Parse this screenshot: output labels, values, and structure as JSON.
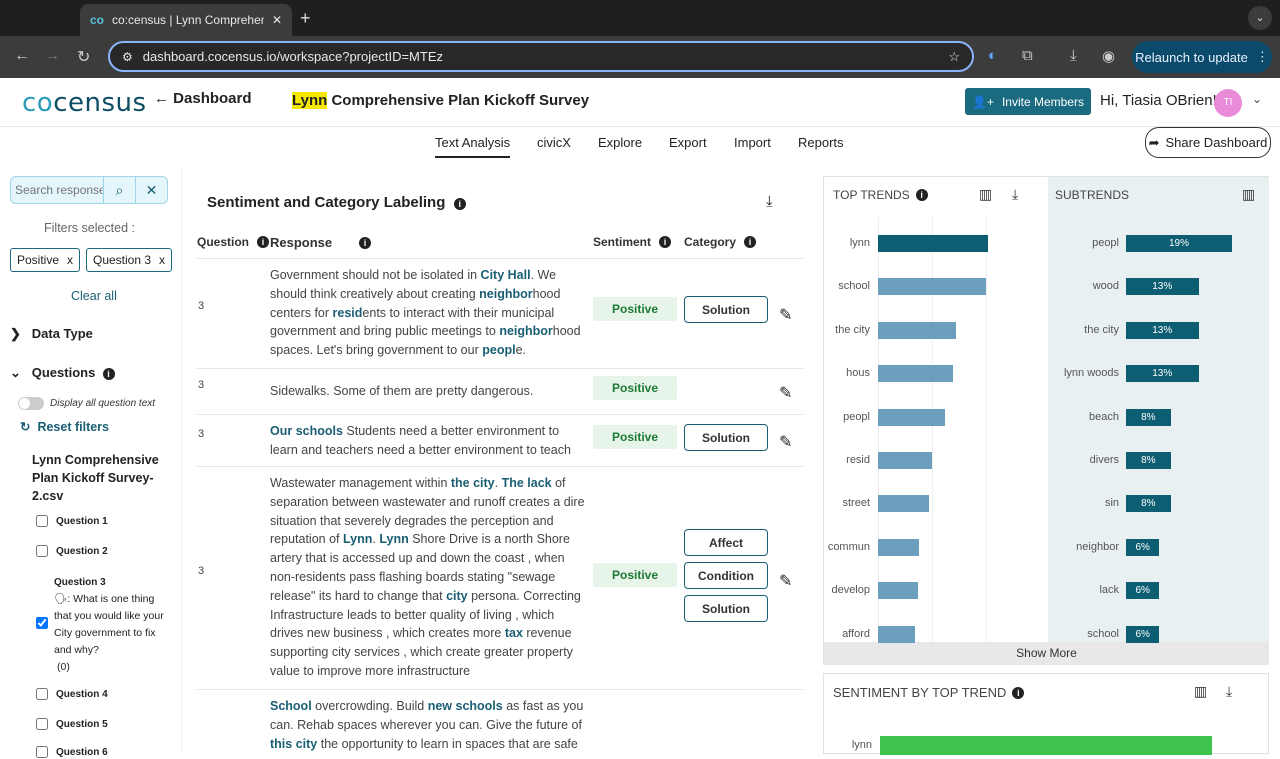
{
  "browser": {
    "tab_title": "co:census | Lynn Comprehensive Plan Kickoff Survey",
    "url": "dashboard.cocensus.io/workspace?projectID=MTEz",
    "relaunch_label": "Relaunch to update"
  },
  "header": {
    "logo_prefix": "co",
    "logo_suffix": "census",
    "back_label": "Dashboard",
    "project_highlight": "Lynn",
    "project_rest": " Comprehensive Plan Kickoff Survey",
    "invite_label": "Invite Members",
    "greeting": "Hi, Tiasia OBrien!",
    "avatar_initials": "TI"
  },
  "nav": {
    "tabs": [
      "Text Analysis",
      "civicX",
      "Explore",
      "Export",
      "Import",
      "Reports"
    ],
    "share_label": "Share Dashboard"
  },
  "sidebar": {
    "search_placeholder": "Search responses",
    "filters_selected": "Filters selected :",
    "chips": [
      "Positive",
      "Question 3"
    ],
    "clear_all": "Clear all",
    "data_type": "Data Type",
    "questions": "Questions",
    "display_all": "Display all question text",
    "reset_filters": "Reset filters",
    "file_name": "Lynn Comprehensive Plan Kickoff Survey-2.csv",
    "question_list": [
      {
        "label": "Question 1",
        "checked": false
      },
      {
        "label": "Question 2",
        "checked": false
      },
      {
        "label": "Question 3",
        "checked": true,
        "text": "🗣: What is one thing that you would like your City government to fix and why?",
        "count": "(0)"
      },
      {
        "label": "Question 4",
        "checked": false
      },
      {
        "label": "Question 5",
        "checked": false
      },
      {
        "label": "Question 6",
        "checked": false
      }
    ]
  },
  "labeling": {
    "title": "Sentiment and Category Labeling",
    "col_question": "Question",
    "col_response": "Response",
    "col_sentiment": "Sentiment",
    "col_category": "Category",
    "rows": [
      {
        "q": "3",
        "sentiment": "Positive",
        "categories": [
          "Solution"
        ]
      },
      {
        "q": "3",
        "sentiment": "Positive",
        "categories": []
      },
      {
        "q": "3",
        "sentiment": "Positive",
        "categories": [
          "Solution"
        ]
      },
      {
        "q": "3",
        "sentiment": "Positive",
        "categories": [
          "Affect",
          "Condition",
          "Solution"
        ]
      },
      {
        "q": "",
        "sentiment": "",
        "categories": []
      }
    ]
  },
  "trends": {
    "top_title": "TOP TRENDS",
    "sub_title": "SUBTRENDS",
    "show_more": "Show More",
    "top": [
      {
        "label": "lynn",
        "value": 100
      },
      {
        "label": "school",
        "value": 98
      },
      {
        "label": "the city",
        "value": 71
      },
      {
        "label": "hous",
        "value": 68
      },
      {
        "label": "peopl",
        "value": 61
      },
      {
        "label": "resid",
        "value": 49
      },
      {
        "label": "street",
        "value": 46
      },
      {
        "label": "commun",
        "value": 37
      },
      {
        "label": "develop",
        "value": 36
      },
      {
        "label": "afford",
        "value": 34
      }
    ],
    "sub": [
      {
        "label": "peopl",
        "value": 19,
        "text": "19%"
      },
      {
        "label": "wood",
        "value": 13,
        "text": "13%"
      },
      {
        "label": "the city",
        "value": 13,
        "text": "13%"
      },
      {
        "label": "lynn woods",
        "value": 13,
        "text": "13%"
      },
      {
        "label": "beach",
        "value": 8,
        "text": "8%"
      },
      {
        "label": "divers",
        "value": 8,
        "text": "8%"
      },
      {
        "label": "sin",
        "value": 8,
        "text": "8%"
      },
      {
        "label": "neighbor",
        "value": 6,
        "text": "6%"
      },
      {
        "label": "lack",
        "value": 6,
        "text": "6%"
      },
      {
        "label": "school",
        "value": 6,
        "text": "6%"
      }
    ],
    "colors": {
      "top_first": "#0d5e73",
      "top_rest": "#6b9fbd",
      "sub": "#0d5e73"
    }
  },
  "sentiment_panel": {
    "title": "SENTIMENT BY TOP TREND",
    "first_label": "lynn",
    "bar_color": "#3ec44d"
  }
}
